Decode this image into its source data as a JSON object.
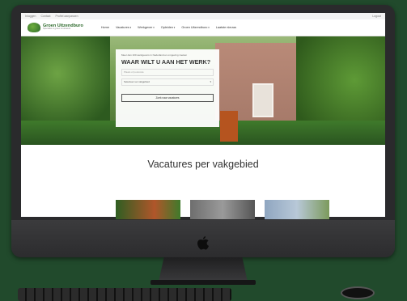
{
  "site": {
    "topbar": {
      "links": [
        "Inloggen",
        "Contact",
        "Profiel aanpassen"
      ],
      "right": "Logout"
    },
    "logo": {
      "name": "Groen Uitzendburo",
      "tagline": "Specialist in groen & tuinwerk"
    },
    "nav": [
      "Home",
      "Vacatures",
      "Werkgever",
      "Opleiden",
      "Groen Uitzendburo",
      "Laatste nieuws"
    ],
    "search": {
      "intro": "Meer dan 100 werkgevers in Nederland en omgeving zoeken",
      "title": "WAAR WILT U AAN HET WERK?",
      "keyword_placeholder": "Plaats of postcode",
      "select_value": "Selecteer uw vakgebied",
      "button": "Zoek naar vacatures"
    },
    "section_title": "Vacatures per vakgebied"
  },
  "colors": {
    "background": "#214a2c",
    "brand": "#2d6a2c"
  },
  "icons": {
    "apple": "apple-logo-icon"
  }
}
